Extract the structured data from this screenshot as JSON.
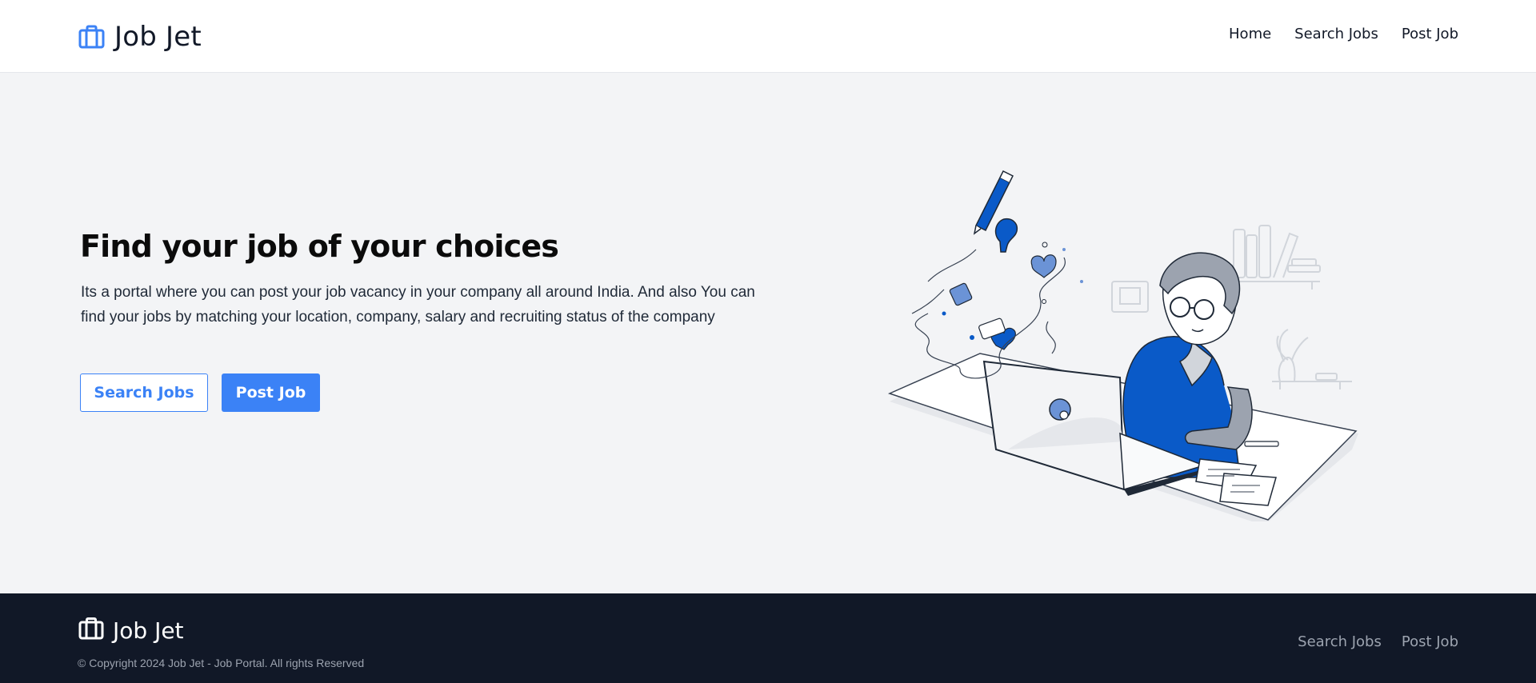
{
  "header": {
    "brand": "Job Jet",
    "brand_icon": "briefcase-icon",
    "nav": [
      "Home",
      "Search Jobs",
      "Post Job"
    ]
  },
  "hero": {
    "title": "Find your job of your choices",
    "description": "Its a portal where you can post your job vacancy in your company all around India. And also You can find your jobs by matching your location, company, salary and recruiting status of the company",
    "buttons": {
      "search_jobs": "Search Jobs",
      "post_job": "Post Job"
    }
  },
  "footer": {
    "brand": "Job Jet",
    "copyright": "© Copyright 2024 Job Jet - Job Portal. All rights Reserved",
    "links": [
      "Search Jobs",
      "Post Job"
    ]
  },
  "colors": {
    "accent": "#3b82f6",
    "illustration_blue": "#0a5ac8",
    "footer_bg": "#111827",
    "page_bg": "#f3f4f6"
  }
}
